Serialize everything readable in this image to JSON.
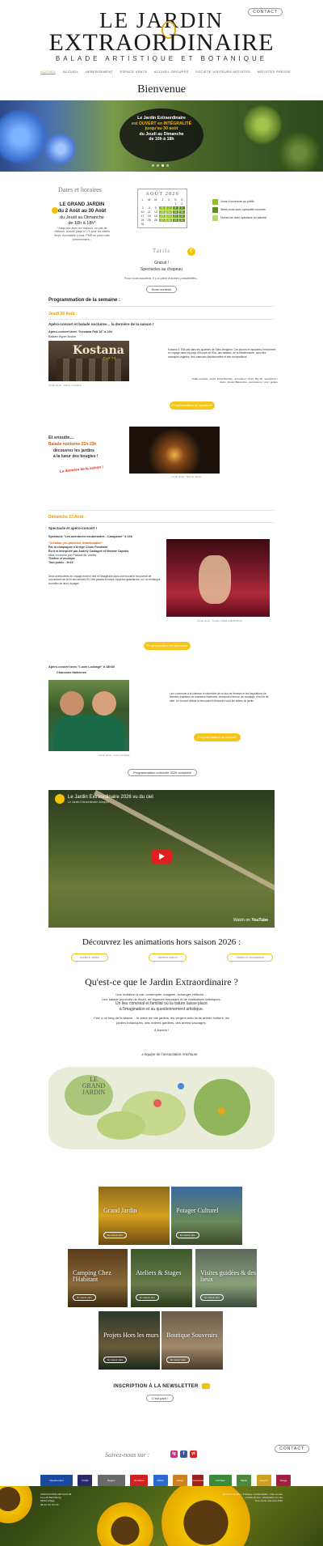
{
  "header": {
    "logo_line1": "LE JARDIN",
    "logo_line2": "EXTRAORDINAIRE",
    "logo_line3": "BALADE ARTISTIQUE ET BOTANIQUE",
    "contact_label": "CONTACT",
    "nav": [
      "ACCUEIL",
      "ACCUEIL",
      "ANIMATIONS",
      "HEBERGEMENT",
      "ESPACE VENTE",
      "ACCUEIL",
      "GROUPES",
      "ESPACE LOISIRS",
      "LIEUX DE DECOUVERTES",
      "SOCIETE",
      "BIENVENUE",
      "ARTISTES",
      "PATRIMOINE"
    ],
    "nav_items": [
      "ACCUEIL",
      "ACCUEIL",
      "HEBERGEMENT",
      "ESPACE VENTE",
      "ACCUEIL GROUPES",
      "SOCIETE VISITEURS ARTISTES",
      "ARTISTES PRESSE"
    ]
  },
  "welcome_title": "Bienvenue",
  "banner": {
    "line1": "Le Jardin Extraordinaire",
    "line2": "est OUVERT en INTÉGRALITÉ",
    "line3": "jusqu'au 30 août",
    "line4": "du Jeudi au Dimanche",
    "line5": "de 10h à 18h"
  },
  "dates": {
    "title": "Dates et horaires",
    "line1": "LE GRAND JARDIN",
    "line2": "du 2 Août au 30 Août",
    "line3": "du Jeudi au Dimanche",
    "line4": "de 10h à 18h*",
    "note": "*Jusqu'aux avec les visiteurs, en pas de visiteurs. Accueil jusqu'à 17h pour les visites libres. Accessible à tous. PMR ne prise mais cheminement..."
  },
  "calendar": {
    "title": "AOÛT 2026",
    "days": [
      "L",
      "M",
      "M",
      "J",
      "V",
      "S",
      "D"
    ],
    "cells": [
      "",
      "",
      "",
      "",
      "",
      "1",
      "2",
      "3",
      "4",
      "5",
      "6",
      "7",
      "8",
      "9",
      "10",
      "11",
      "12",
      "13",
      "14",
      "15",
      "16",
      "17",
      "18",
      "19",
      "20",
      "21",
      "22",
      "23",
      "24",
      "25",
      "26",
      "27",
      "28",
      "29",
      "30",
      "31",
      "",
      "",
      "",
      "",
      "",
      ""
    ],
    "legend": [
      "Jours d'ouverture au public",
      "Week-ends avec spécialité concerts",
      "Dimanche avec spectacle du samedi"
    ]
  },
  "tarifs": {
    "title": "Tarifs",
    "line1": "Gratuit !",
    "line2": "Spectacles au chapeau",
    "note": "Pour nous soutenir, il y a plein d'autres possibilités...",
    "button": "Nous soutenir"
  },
  "program": {
    "title": "Programmation de la semaine :",
    "day1": "Jeudi 20 Août :",
    "day1_heading": "Apéro-concert et balade nocturne… la dernière de la saison !",
    "day1_concert": "Apéro-concert avec \"Kostana Fait 14\" à 19h",
    "day1_concert_sub": "Balkan Hyper-fusion",
    "day1_photo_text": "Kostana",
    "day1_photo_sub": "Fait 14",
    "day1_desc": "Kostana Il, Ell/Lostl dans les quartiers de Saint-Hengrine, Ces jeunes et musiciens l'emmenent en voyage dans les pays d'Europe de l'Est, des balkans, de la Méditerranée, avec des musiques tziganes, des chansons traditionnelles et des compositions.",
    "day1_desc2": "Fidèle Gorgias - chant, Erixa Mondiay - accordéon / chant, Big Tilt - saxophone / violon, Jiovani Bakounine - percussions / voix / guitare",
    "day1_button": "Programmation du spectacle",
    "day1_caption": "Crédit photo : Fait Fi / Kostana",
    "ensuite_1": "Et ensuite…",
    "ensuite_2": "Balade nocturne 21h-23h",
    "ensuite_3": "découvrez les jardins",
    "ensuite_4": "à la lueur des bougies !",
    "derniere": "La dernière de la saison !",
    "night_caption": "Crédit photo : Nuit de Jardin",
    "day2": "Dimanche 23 Août :",
    "day2_heading": "Spectacle et apéro-concert !",
    "day2_spectacle": "Spectacle \"Les aventures exubérantes - Campaner\" à 16h",
    "day2_lines": [
      "\"Création, jeu-parcours, déambulation\"",
      "Par la compagnie d'Ariège Chuin Fondraite",
      "Écrit et interprété par Audrey Castagné et Noémie Caprais",
      "Mise en scène par Patricia de Volette",
      "Théâtre et musique",
      "Tout public - 1h15"
    ],
    "day2_para": "Deux aventurières en voyage entre le réel et l'imaginaire dans une brocante recouverte de couvertures de la fin des années 50. Des passés et futurs, épopées galactiques, où l'on embarque au milieu de leurs voyages.",
    "day2_caption": "Crédit photo : Tristan GUERCHENKOFFE",
    "day2_button": "Programmation du spectacle",
    "day2_concert": "Apéro-concert avec \"Lucie Loubagé\" à 18h30",
    "day2_concert_sub": "Chansons Italiennes",
    "day2_concert_desc": "Leur commune à la chanson le répertoire de ce duo de femmes et les inspirations de diverses traditions de chansons italiennes, chansons d'amour, de nostalgie, d'exil et de lutte. Un concert délicat et émouvant à découvrir sous les arbres du jardin.",
    "day2_concert_caption": "Crédit photo : Lucie Loubagé",
    "day2_concert_button": "Programmation du concert",
    "full_prog_button": "Programmation culturelle 2026 complète"
  },
  "video": {
    "title": "Le Jardin Extraordinaire 2026 vu du ciel",
    "subtitle": "Le Jardin Extraordinaire Arlequin",
    "watch_on": "Watch on",
    "yt": "YouTube"
  },
  "animations": {
    "title": "Découvrez les animations hors saison 2026 :",
    "buttons": [
      "Ateliers Jardin",
      "Ateliers nature",
      "Visites et animations"
    ]
  },
  "about": {
    "title": "Qu'est-ce que le Jardin Extraordinaire ?",
    "text1": "Une invitation à voir, contempler, imaginer, échanger, réfléchir…",
    "text2": "Une balade ponctuée de fleurs, de légumes sauvages et de réalisations artistiques.",
    "text3": "Un lieu convivial et familial où la nature laisse place",
    "text4": "à l'imagination et au questionnement artistique.",
    "text5": "Ceci a un long de la saison… le cœur de nos jardins, les vergers avec leurs arbres fruitiers, les jardins botaniques, des rivières gardées, des arbres sauvages.",
    "bientot": "À bientôt !",
    "sign": "L'équipe de l'association Artchoum"
  },
  "map": {
    "label": "LE GRAND JARDIN"
  },
  "tiles": [
    {
      "label": "Grand Jardin",
      "btn": "En savoir plus"
    },
    {
      "label": "Potager Culturel",
      "btn": "En savoir plus"
    },
    {
      "label": "Camping Chez l'Habitant",
      "btn": "En savoir plus"
    },
    {
      "label": "Ateliers & Stages",
      "btn": "En savoir plus"
    },
    {
      "label": "Visites guidées & des lieux",
      "btn": "En savoir plus"
    },
    {
      "label": "Projets Hors les murs",
      "btn": "En savoir plus"
    },
    {
      "label": "Boutique Souvenirs",
      "btn": "En savoir plus"
    }
  ],
  "newsletter": {
    "label": "INSCRIPTION À LA NEWSLETTER",
    "button": "C'est parti !"
  },
  "footer": {
    "follow": "Suivez-nous sur :",
    "social": [
      "ig",
      "f",
      "yt"
    ],
    "contact_label": "CONTACT",
    "partners": [
      "Département",
      "Préfet",
      "Région",
      "Occitanie",
      "CERA",
      "Ariège",
      "Commune",
      "Artichaut",
      "Mairie",
      "Aveyron",
      "Ariège"
    ],
    "address_left": "ASSOCIATION ARTCHOUM\nLieu-dit Barthélémy\n09210 Ariège\n06 XX XX XX XX",
    "address_right": "Mentions légales • Politique confidentialité • Plan du site\nCrédits photos • Réalisation du site\nTous droits réservés 2026"
  },
  "colors": {
    "accent": "#f2c200",
    "orange": "#e69a00",
    "red": "#d95a00",
    "green": "#8fbf2b"
  }
}
